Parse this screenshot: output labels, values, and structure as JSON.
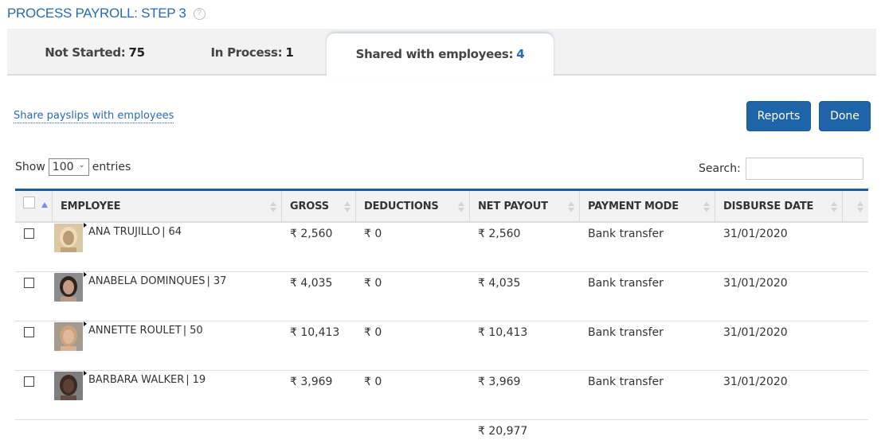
{
  "page": {
    "title": "PROCESS PAYROLL: STEP 3",
    "help_icon": "?"
  },
  "tabs": [
    {
      "label": "Not Started:",
      "count": "75",
      "active": false
    },
    {
      "label": "In Process:",
      "count": "1",
      "active": false
    },
    {
      "label": "Shared with employees:",
      "count": "4",
      "active": true
    }
  ],
  "actions": {
    "share_link": "Share payslips with employees",
    "reports_label": "Reports",
    "done_label": "Done"
  },
  "table_controls": {
    "show_label": "Show",
    "entries_value": "100",
    "entries_label": "entries",
    "search_label": "Search:",
    "search_value": "",
    "chevron": "⌄"
  },
  "columns": [
    "EMPLOYEE",
    "GROSS",
    "DEDUCTIONS",
    "NET PAYOUT",
    "PAYMENT MODE",
    "DISBURSE DATE"
  ],
  "rows": [
    {
      "name": "ANA TRUJILLO",
      "id": "64",
      "gross": "₹ 2,560",
      "deductions": "₹ 0",
      "net": "₹ 2,560",
      "mode": "Bank transfer",
      "date": "31/01/2020",
      "avatar_colors": [
        "#d9c7a6",
        "#f0dcb0",
        "#b89a74"
      ]
    },
    {
      "name": "ANABELA DOMINQUES",
      "id": "37",
      "gross": "₹ 4,035",
      "deductions": "₹ 0",
      "net": "₹ 4,035",
      "mode": "Bank transfer",
      "date": "31/01/2020",
      "avatar_colors": [
        "#8c8c8c",
        "#2b2420",
        "#c79a86"
      ]
    },
    {
      "name": "ANNETTE ROULET",
      "id": "50",
      "gross": "₹ 10,413",
      "deductions": "₹ 0",
      "net": "₹ 10,413",
      "mode": "Bank transfer",
      "date": "31/01/2020",
      "avatar_colors": [
        "#a59a8e",
        "#c9a47a",
        "#e0b89a"
      ]
    },
    {
      "name": "BARBARA WALKER",
      "id": "19",
      "gross": "₹ 3,969",
      "deductions": "₹ 0",
      "net": "₹ 3,969",
      "mode": "Bank transfer",
      "date": "31/01/2020",
      "avatar_colors": [
        "#7e7e7e",
        "#3a2a22",
        "#5c4034"
      ]
    }
  ],
  "totals": {
    "net_payout": "₹ 20,977"
  }
}
